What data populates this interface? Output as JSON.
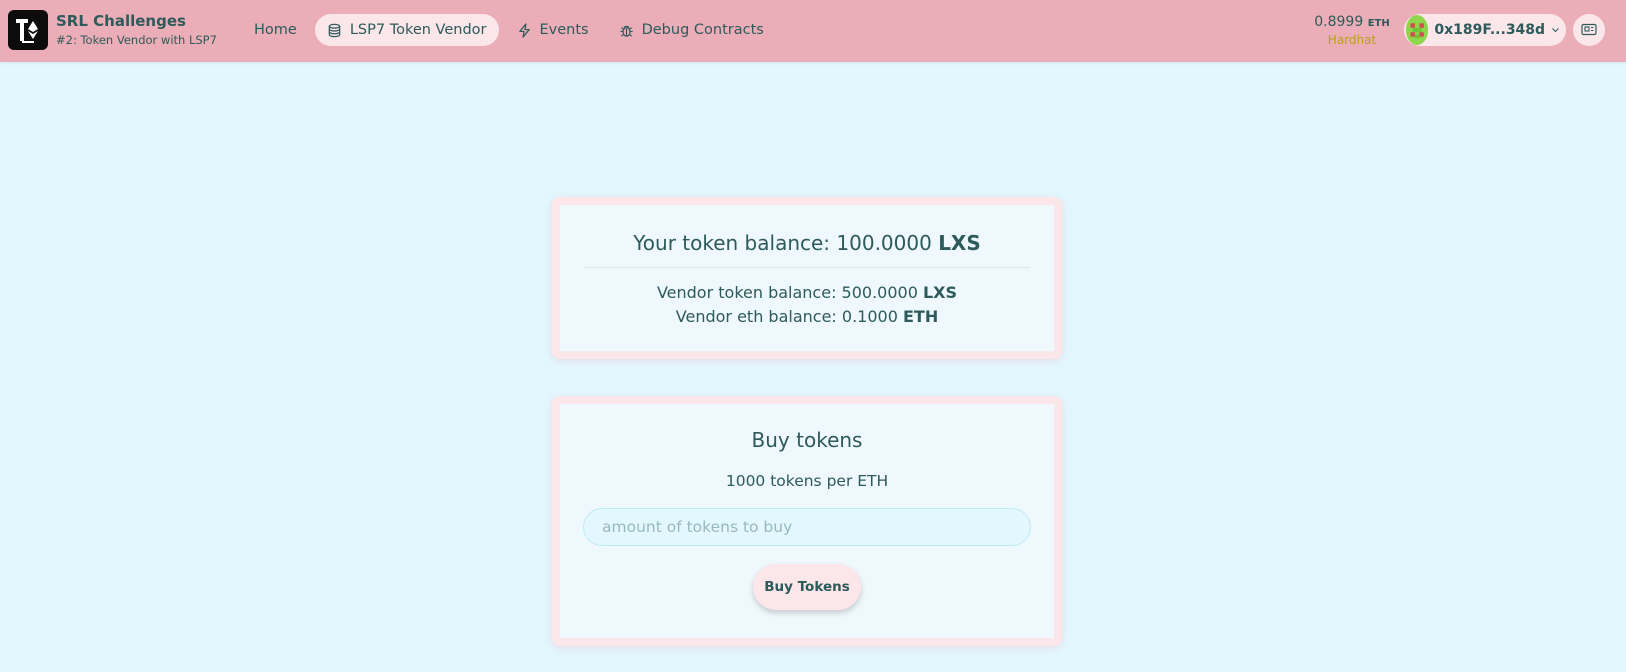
{
  "header": {
    "brand_title": "SRL Challenges",
    "brand_subtitle": "#2: Token Vendor with LSP7",
    "nav": [
      {
        "label": "Home",
        "icon": "none",
        "active": false
      },
      {
        "label": "LSP7 Token Vendor",
        "icon": "coins-icon",
        "active": true
      },
      {
        "label": "Events",
        "icon": "bolt-icon",
        "active": false
      },
      {
        "label": "Debug Contracts",
        "icon": "bug-icon",
        "active": false
      }
    ],
    "balance_value": "0.8999",
    "balance_unit": "ETH",
    "network": "Hardhat",
    "account_address": "0x189F...348d"
  },
  "balances": {
    "your_label": "Your token balance: 100.0000",
    "your_unit": "LXS",
    "vendor_token_label": "Vendor token balance: 500.0000",
    "vendor_token_unit": "LXS",
    "vendor_eth_label": "Vendor eth balance: 0.1000",
    "vendor_eth_unit": "ETH"
  },
  "buy": {
    "title": "Buy tokens",
    "rate": "1000 tokens per ETH",
    "input_placeholder": "amount of tokens to buy",
    "input_value": "",
    "button_label": "Buy Tokens"
  },
  "colors": {
    "header_bg": "#ebaeb8",
    "page_bg": "#e3f7ff",
    "card_border": "#fbe6ea",
    "text": "#2d5a5a",
    "network": "#b8a214"
  }
}
